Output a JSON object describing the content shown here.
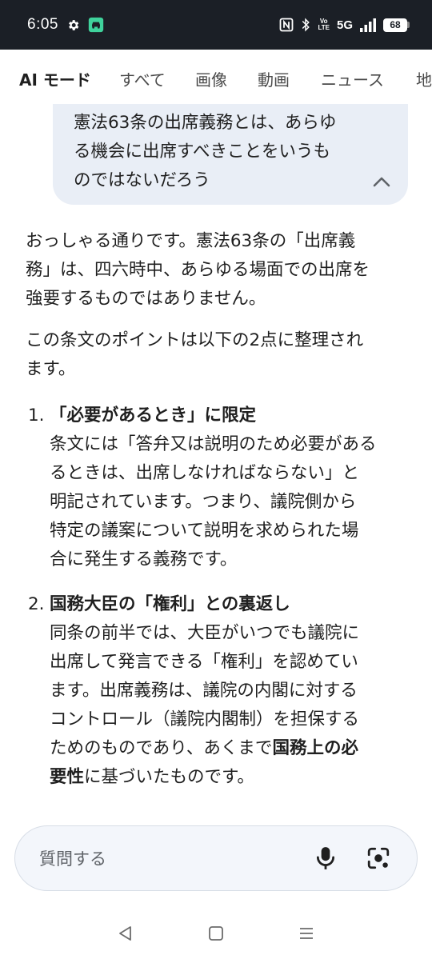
{
  "status_bar": {
    "time": "6:05",
    "volte_top": "Vo",
    "volte_bottom": "LTE",
    "network": "5G",
    "battery": "68"
  },
  "tabs": [
    {
      "label": "AI モード",
      "active": true
    },
    {
      "label": "すべて"
    },
    {
      "label": "画像"
    },
    {
      "label": "動画"
    },
    {
      "label": "ニュース"
    },
    {
      "label": "地"
    }
  ],
  "query": {
    "lines": [
      "憲法63条の出席義務とは、あらゆ",
      "る機会に出席すべきことをいうも",
      "のではないだろう"
    ]
  },
  "answer": {
    "p1_lines": [
      "おっしゃる通りです。憲法63条の「出席義",
      "務」は、四六時中、あらゆる場面での出席を",
      "強要するものではありません。"
    ],
    "p2_lines": [
      "この条文のポイントは以下の2点に整理され",
      "ます。"
    ],
    "items": [
      {
        "num": "1.",
        "title": "「必要があるとき」に限定",
        "body_lines": [
          "条文には「答弁又は説明のため必要がある",
          "るときは、出席しなければならない」と",
          "明記されています。つまり、議院側から",
          "特定の議案について説明を求められた場",
          "合に発生する義務です。"
        ]
      },
      {
        "num": "2.",
        "title": "国務大臣の「権利」との裏返し",
        "body_lines": [
          "同条の前半では、大臣がいつでも議院に",
          "出席して発言できる「権利」を認めてい",
          "ます。出席義務は、議院の内閣に対する",
          "コントロール（議院内閣制）を担保する"
        ],
        "line5_pre": "ためのものであり、あくまで",
        "line5_bold": "国務上の必",
        "line6_bold": "要性",
        "line6_post": "に基づいたものです。"
      }
    ]
  },
  "input": {
    "placeholder": "質問する"
  },
  "icons": {
    "settings": "gear-icon",
    "car": "car-icon",
    "nfc": "nfc-icon",
    "bluetooth": "bluetooth-icon",
    "signal": "signal-icon",
    "battery": "battery-icon",
    "collapse": "chevron-up-icon",
    "mic": "microphone-icon",
    "lens": "camera-lens-icon",
    "back": "back-triangle-icon",
    "home": "home-square-icon",
    "recents": "recents-menu-icon"
  },
  "colors": {
    "status_bar_bg": "#1b1f26",
    "bubble_bg": "#e9eef6",
    "input_bg": "#f3f6fb"
  }
}
